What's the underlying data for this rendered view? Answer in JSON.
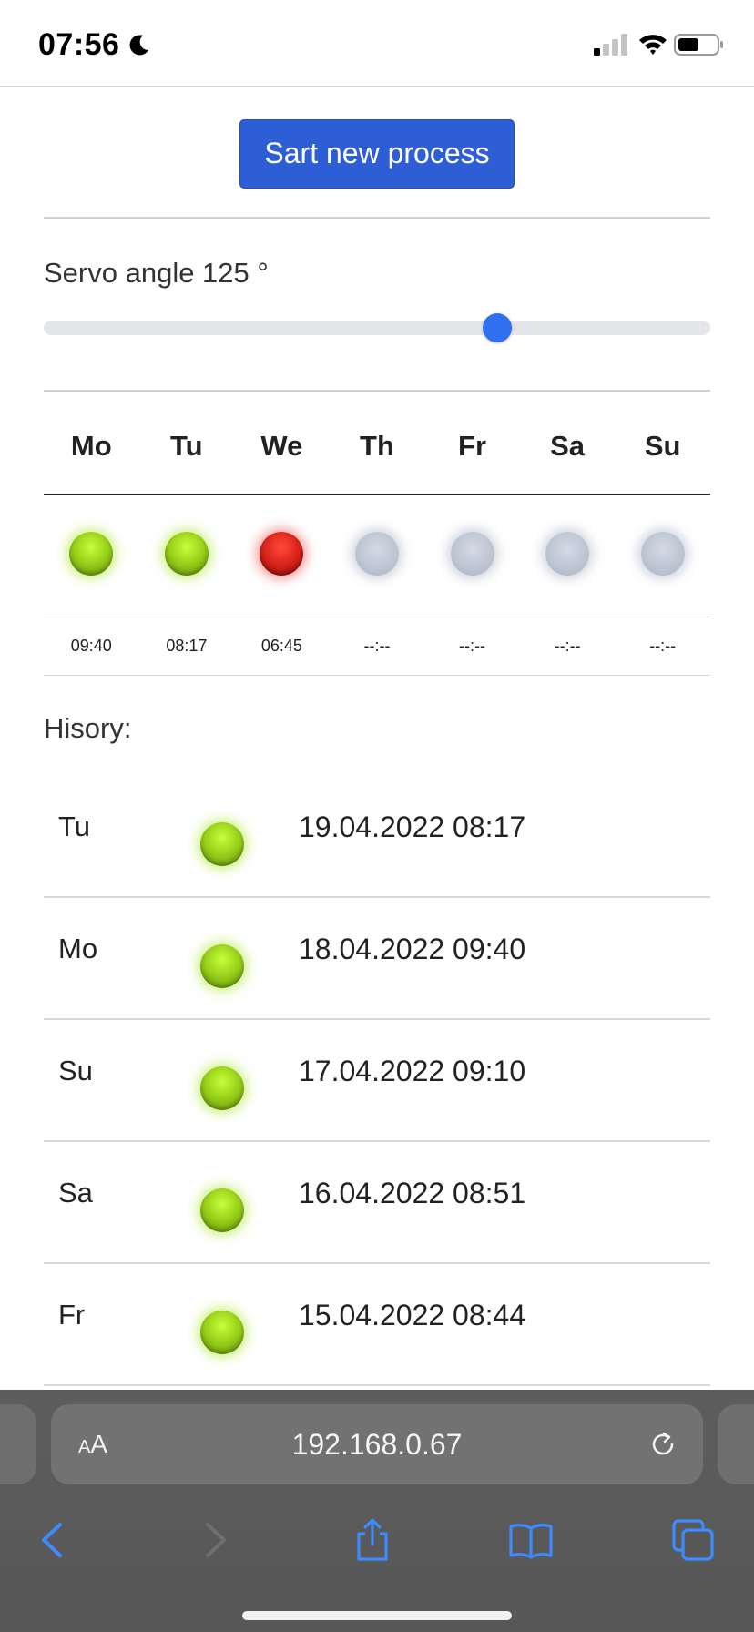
{
  "status_bar": {
    "time": "07:56"
  },
  "actions": {
    "start_label": "Sart new process"
  },
  "servo": {
    "label": "Servo angle 125 °",
    "value": 125,
    "max": 180
  },
  "week": {
    "days": [
      "Mo",
      "Tu",
      "We",
      "Th",
      "Fr",
      "Sa",
      "Su"
    ],
    "status": [
      "green",
      "green",
      "red",
      "gray",
      "gray",
      "gray",
      "gray"
    ],
    "times": [
      "09:40",
      "08:17",
      "06:45",
      "--:--",
      "--:--",
      "--:--",
      "--:--"
    ]
  },
  "history": {
    "title": "Hisory:",
    "entries": [
      {
        "day": "Tu",
        "status": "green",
        "datetime": "19.04.2022 08:17"
      },
      {
        "day": "Mo",
        "status": "green",
        "datetime": "18.04.2022 09:40"
      },
      {
        "day": "Su",
        "status": "green",
        "datetime": "17.04.2022 09:10"
      },
      {
        "day": "Sa",
        "status": "green",
        "datetime": "16.04.2022 08:51"
      },
      {
        "day": "Fr",
        "status": "green",
        "datetime": "15.04.2022 08:44"
      }
    ]
  },
  "browser": {
    "url": "192.168.0.67",
    "text_size_label": "AA"
  },
  "colors": {
    "accent": "#2d5ed6",
    "green_led": "#9ad21a",
    "red_led": "#d9231a",
    "gray_led": "#bcc4d2"
  }
}
